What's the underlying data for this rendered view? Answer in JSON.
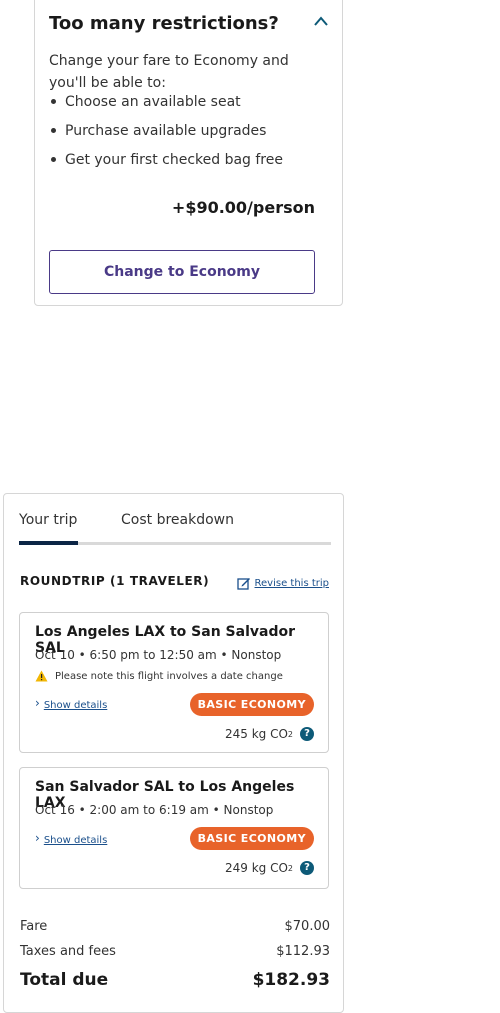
{
  "restrictions": {
    "title": "Too many restrictions?",
    "intro": "Change your fare to Economy and you'll be able to:",
    "benefits": [
      "Choose an available seat",
      "Purchase available upgrades",
      "Get your first checked bag free"
    ],
    "price": "+$90.00/person",
    "button_label": "Change to Economy"
  },
  "summary": {
    "tabs": [
      "Your trip",
      "Cost breakdown"
    ],
    "trip_heading": "ROUNDTRIP (1 TRAVELER)",
    "revise_label": "Revise this trip",
    "segments": [
      {
        "route": "Los Angeles LAX to San Salvador SAL",
        "times": "Oct 10 • 6:50 pm to 12:50 am • Nonstop",
        "note": "Please note this flight involves a date change",
        "details_label": "Show details",
        "fare_class": "BASIC ECONOMY",
        "co2": "245 kg CO",
        "co2_sub": "2",
        "help": "?"
      },
      {
        "route": "San Salvador SAL to Los Angeles LAX",
        "times": "Oct 16 • 2:00 am to 6:19 am • Nonstop",
        "details_label": "Show details",
        "fare_class": "BASIC ECONOMY",
        "co2": "249 kg CO",
        "co2_sub": "2",
        "help": "?"
      }
    ],
    "costs": [
      {
        "label": "Fare",
        "amount": "$70.00"
      },
      {
        "label": "Taxes and fees",
        "amount": "$112.93"
      }
    ],
    "total": {
      "label": "Total due",
      "amount": "$182.93"
    }
  },
  "colors": {
    "accent": "#4a3a87",
    "badge": "#e8632a",
    "link": "#1a4f8b",
    "tab_active": "#0b2545",
    "help_icon": "#0d5a78"
  },
  "icons": [
    "chevron-up-icon",
    "bullet-icon",
    "edit-icon",
    "warning-icon",
    "chevron-right-icon",
    "help-icon"
  ]
}
